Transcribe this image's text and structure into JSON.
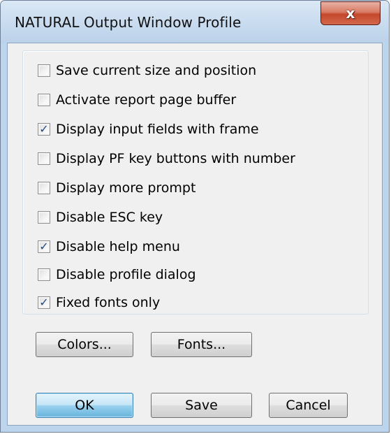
{
  "window": {
    "title": "NATURAL Output Window Profile",
    "close_glyph": "x"
  },
  "options": [
    {
      "label": "Save current size and position",
      "checked": false
    },
    {
      "label": "Activate report page buffer",
      "checked": false
    },
    {
      "label": "Display input fields with frame",
      "checked": true
    },
    {
      "label": "Display PF key buttons with number",
      "checked": false
    },
    {
      "label": "Display more prompt",
      "checked": false
    },
    {
      "label": "Disable ESC key",
      "checked": false
    },
    {
      "label": "Disable help menu",
      "checked": true
    },
    {
      "label": "Disable profile dialog",
      "checked": false
    },
    {
      "label": "Fixed fonts only",
      "checked": true
    }
  ],
  "buttons": {
    "colors": "Colors...",
    "fonts": "Fonts...",
    "ok": "OK",
    "save": "Save",
    "cancel": "Cancel"
  },
  "checkmark_glyph": "✓"
}
